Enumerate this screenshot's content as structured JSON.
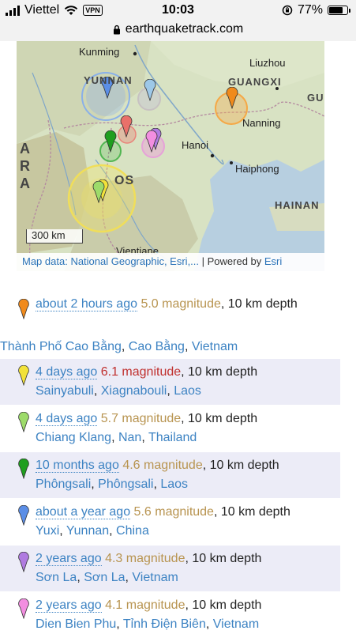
{
  "status": {
    "carrier": "Viettel",
    "vpn": "VPN",
    "time": "10:03",
    "battery": "77%",
    "battery_level": 0.77
  },
  "browser": {
    "url": "earthquaketrack.com"
  },
  "map": {
    "labels": {
      "kunming": "Kunming",
      "yunnan": "YUNNAN",
      "liuzhou": "Liuzhou",
      "guangxi": "GUANGXI",
      "gu": "GU",
      "nanning": "Nanning",
      "hanoi": "Hanoi",
      "haiphong": "Haiphong",
      "hainan": "HAINAN",
      "laos": "OS",
      "ara": "A R A",
      "vientiane": "Vientiane"
    },
    "scale": "300 km",
    "attribution_prefix": "Map data: ",
    "attribution_link": "National Geographic, Esri,...",
    "powered_by": " | Powered by ",
    "esri": "Esri"
  },
  "quakes": [
    {
      "ago": "about 2 hours ago",
      "magnitude": "5.0 magnitude",
      "depth": ", 10 km depth",
      "place": [
        "Thành Phố Cao Bằng",
        "Cao Bằng",
        "Vietnam"
      ],
      "pin_color": "#f08a1c",
      "mag_color": "#b89450"
    },
    {
      "ago": "4 days ago",
      "magnitude": "6.1 magnitude",
      "depth": ", 10 km depth",
      "place": [
        "Sainyabuli",
        "Xiagnabouli",
        "Laos"
      ],
      "pin_color": "#f2e23a",
      "mag_color": "#c0302e"
    },
    {
      "ago": "4 days ago",
      "magnitude": "5.7 magnitude",
      "depth": ", 10 km depth",
      "place": [
        "Chiang Klang",
        "Nan",
        "Thailand"
      ],
      "pin_color": "#9ddb6a",
      "mag_color": "#b89450"
    },
    {
      "ago": "10 months ago",
      "magnitude": "4.6 magnitude",
      "depth": ", 10 km depth",
      "place": [
        "Phôngsali",
        "Phôngsali",
        "Laos"
      ],
      "pin_color": "#1f9e1f",
      "mag_color": "#b89450"
    },
    {
      "ago": "about a year ago",
      "magnitude": "5.6 magnitude",
      "depth": ", 10 km depth",
      "place": [
        "Yuxi",
        "Yunnan",
        "China"
      ],
      "pin_color": "#5b8ee6",
      "mag_color": "#b89450"
    },
    {
      "ago": "2 years ago",
      "magnitude": "4.3 magnitude",
      "depth": ", 10 km depth",
      "place": [
        "Sơn La",
        "Sơn La",
        "Vietnam"
      ],
      "pin_color": "#b07be0",
      "mag_color": "#b89450"
    },
    {
      "ago": "2 years ago",
      "magnitude": "4.1 magnitude",
      "depth": ", 10 km depth",
      "place": [
        "Dien Bien Phu",
        "Tỉnh Điện Biên",
        "Vietnam"
      ],
      "pin_color": "#f28ee0",
      "mag_color": "#b89450"
    }
  ],
  "sep": ", "
}
